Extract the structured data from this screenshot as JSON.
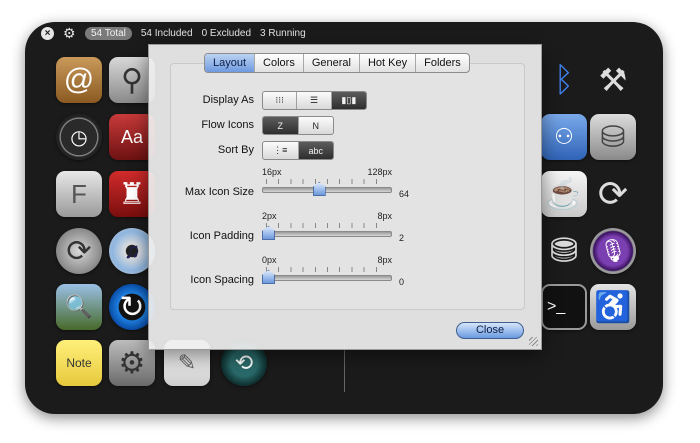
{
  "status_bar": {
    "total": "54 Total",
    "included": "54 Included",
    "excluded": "0 Excluded",
    "running": "3 Running"
  },
  "prefs": {
    "tabs": [
      "Layout",
      "Colors",
      "General",
      "Hot Key",
      "Folders"
    ],
    "active_tab": "Layout",
    "display_as": {
      "label": "Display As",
      "selected_index": 2
    },
    "flow_icons": {
      "label": "Flow Icons",
      "selected_index": 0
    },
    "sort_by": {
      "label": "Sort By",
      "selected_index": 1,
      "second_segment_text": "abc"
    },
    "max_icon_size": {
      "label": "Max Icon Size",
      "min_label": "16px",
      "max_label": "128px",
      "value": "64",
      "fraction": 0.43
    },
    "icon_padding": {
      "label": "Icon Padding",
      "min_label": "2px",
      "max_label": "8px",
      "value": "2",
      "fraction": 0.0
    },
    "icon_spacing": {
      "label": "Icon Spacing",
      "min_label": "0px",
      "max_label": "8px",
      "value": "0",
      "fraction": 0.0
    },
    "close_label": "Close"
  },
  "icons": {
    "left": [
      "address-book-icon",
      "plugin-icon",
      "dashboard-icon",
      "dictionary-icon",
      "font-icon",
      "chair-icon",
      "sync-icon",
      "dvd-icon",
      "photo-icon",
      "refresh-icon",
      "stickies-icon",
      "system-preferences-icon",
      "text-edit-icon",
      "time-machine-icon"
    ],
    "right": [
      "bluetooth-icon",
      "utilities-icon",
      "network-icon",
      "drive-icon",
      "coffee-icon",
      "sync-arrows-icon",
      "database-icon",
      "podcast-icon",
      "terminal-icon",
      "accessibility-icon"
    ]
  },
  "colors": {
    "accent": "#6f9ae0",
    "frame": "#1b1b1b"
  }
}
